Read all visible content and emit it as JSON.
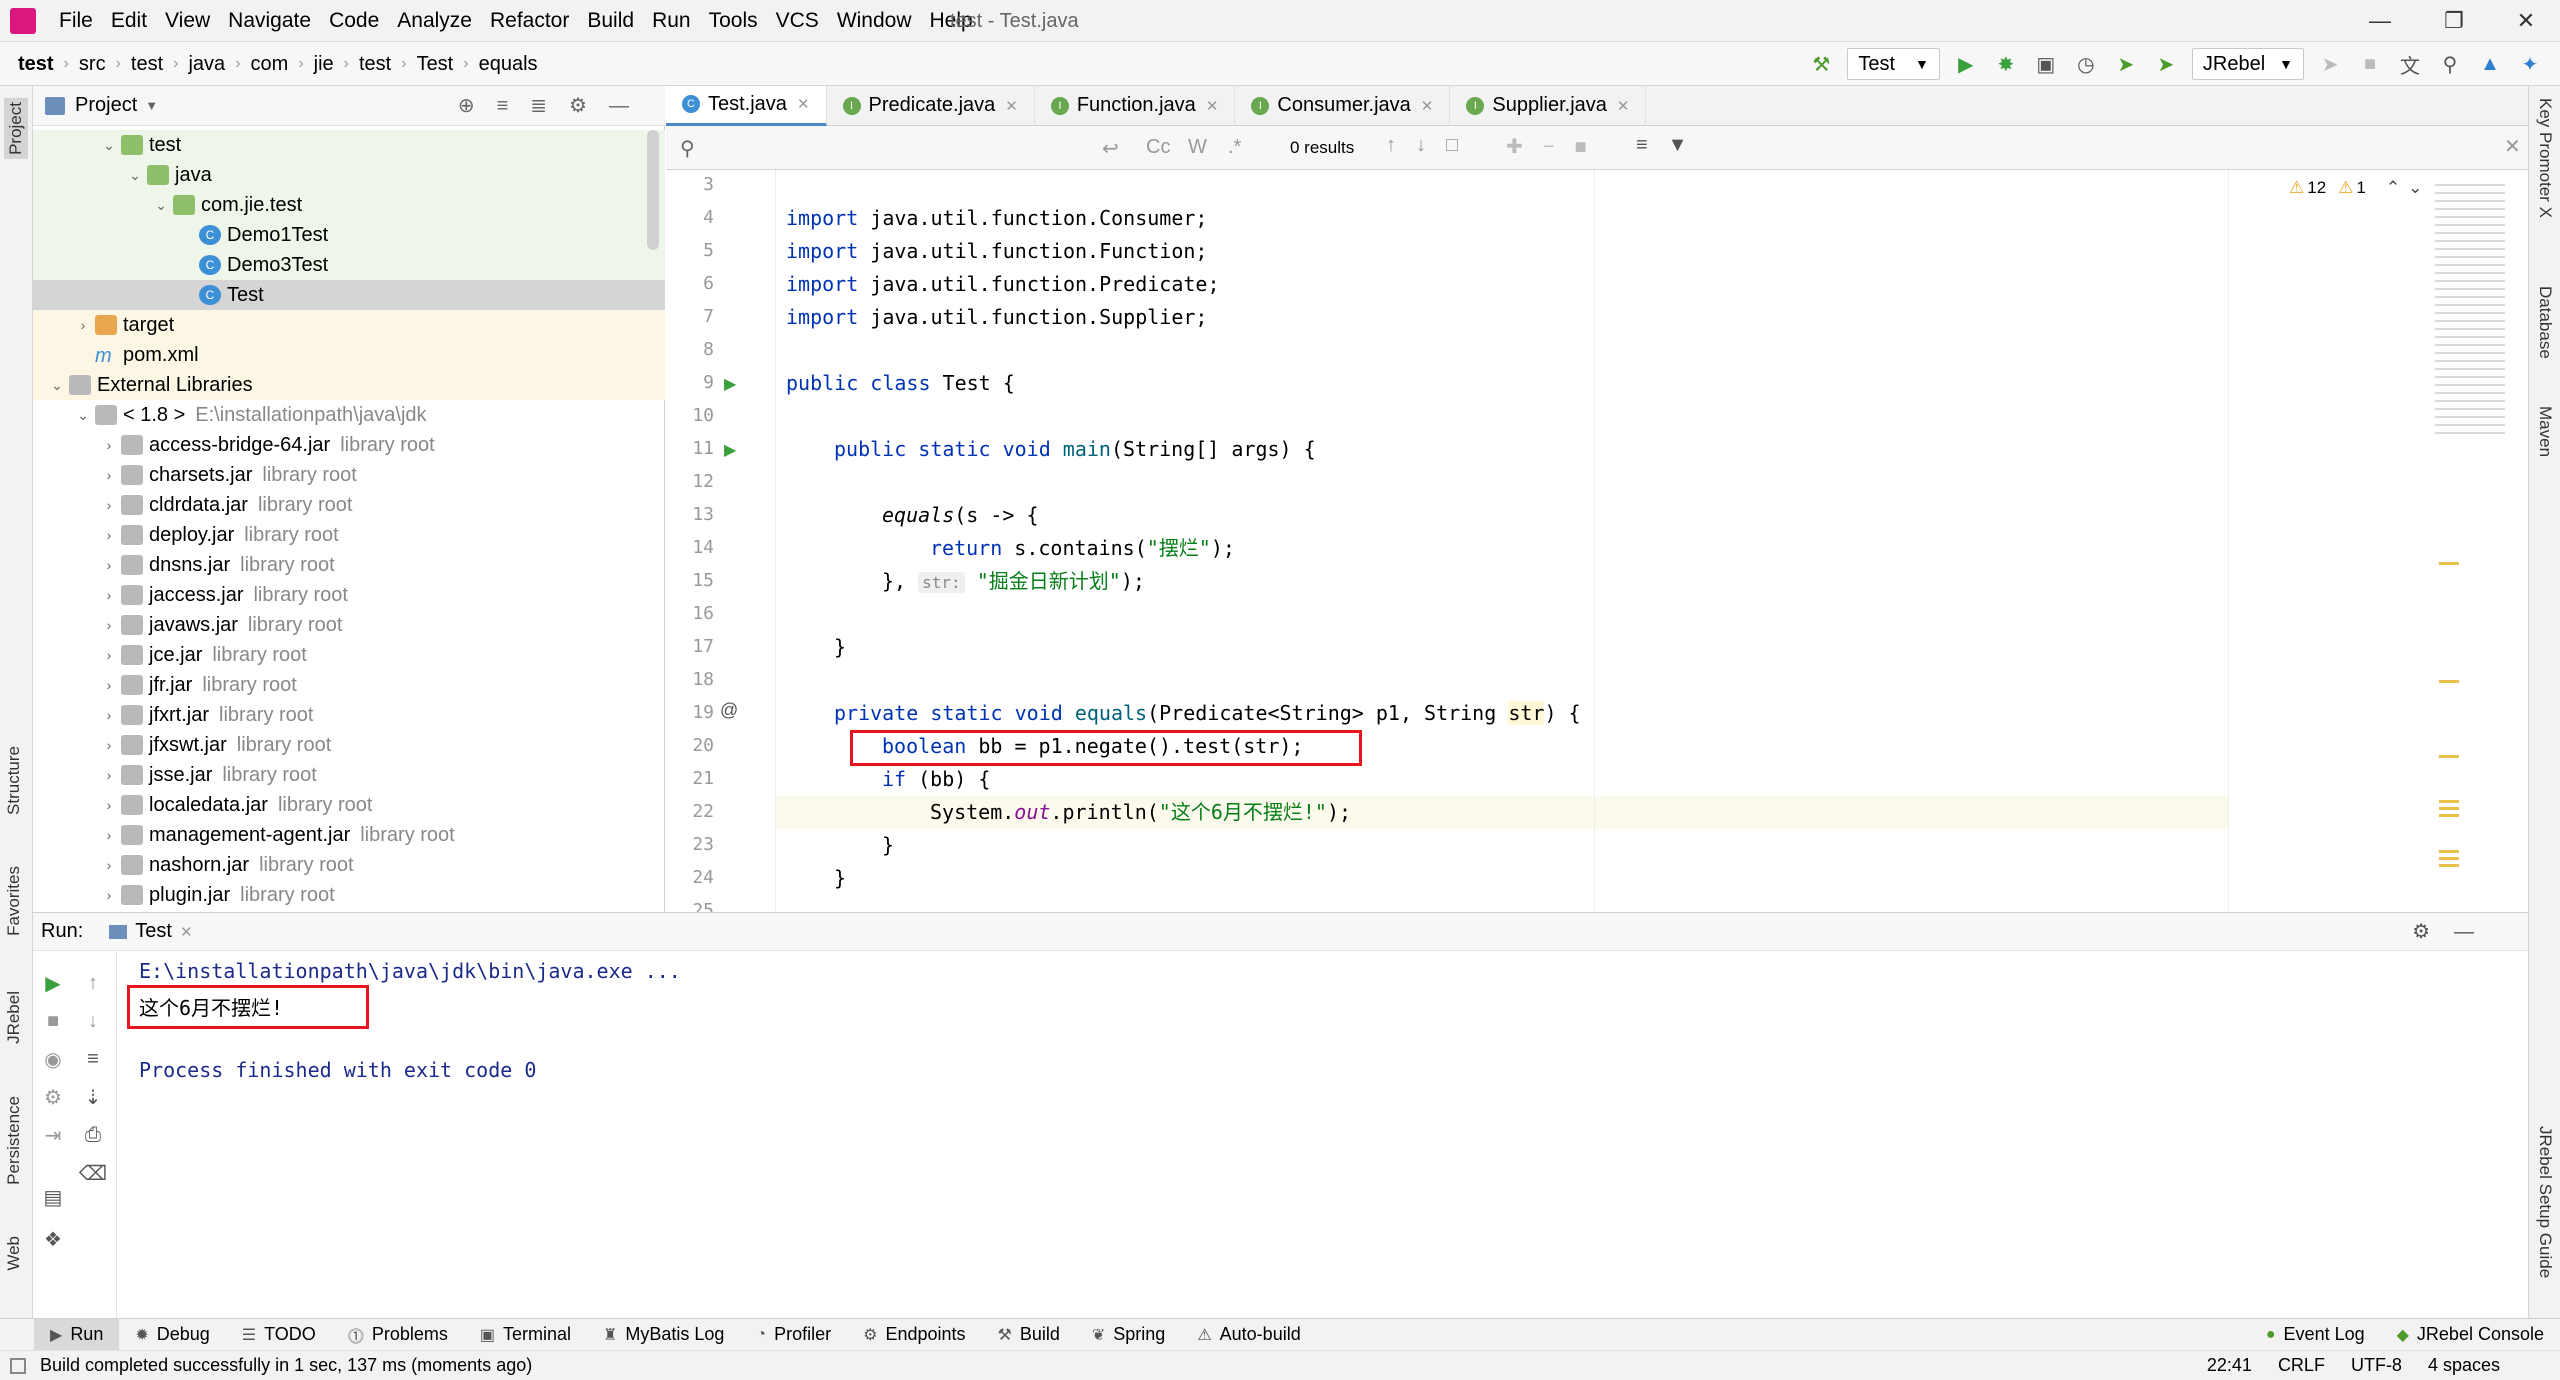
{
  "menu": [
    "File",
    "Edit",
    "View",
    "Navigate",
    "Code",
    "Analyze",
    "Refactor",
    "Build",
    "Run",
    "Tools",
    "VCS",
    "Window",
    "Help"
  ],
  "window_title": "test - Test.java",
  "breadcrumbs": [
    "test",
    "src",
    "test",
    "java",
    "com",
    "jie",
    "test",
    "Test",
    "equals"
  ],
  "toolbar": {
    "run_config": "Test",
    "jrebel": "JRebel"
  },
  "project": {
    "title": "Project",
    "items": [
      {
        "indent": 2,
        "arrow": "v",
        "icon": "fold",
        "label": "test"
      },
      {
        "indent": 3,
        "arrow": "v",
        "icon": "fold",
        "label": "java"
      },
      {
        "indent": 4,
        "arrow": "v",
        "icon": "pkg",
        "label": "com.jie.test"
      },
      {
        "indent": 5,
        "arrow": "",
        "icon": "cls",
        "label": "Demo1Test"
      },
      {
        "indent": 5,
        "arrow": "",
        "icon": "cls",
        "label": "Demo3Test"
      },
      {
        "indent": 5,
        "arrow": "",
        "icon": "cls",
        "label": "Test"
      },
      {
        "indent": 1,
        "arrow": ">",
        "icon": "foldo",
        "label": "target"
      },
      {
        "indent": 1,
        "arrow": "",
        "icon": "m",
        "label": "pom.xml"
      },
      {
        "indent": 0,
        "arrow": "v",
        "icon": "lib",
        "label": "External Libraries"
      },
      {
        "indent": 1,
        "arrow": "v",
        "icon": "jdk",
        "label": "< 1.8 >",
        "extra": "E:\\installationpath\\java\\jdk"
      },
      {
        "indent": 2,
        "arrow": ">",
        "icon": "jar",
        "label": "access-bridge-64.jar",
        "extra": "library root"
      },
      {
        "indent": 2,
        "arrow": ">",
        "icon": "jar",
        "label": "charsets.jar",
        "extra": "library root"
      },
      {
        "indent": 2,
        "arrow": ">",
        "icon": "jar",
        "label": "cldrdata.jar",
        "extra": "library root"
      },
      {
        "indent": 2,
        "arrow": ">",
        "icon": "jar",
        "label": "deploy.jar",
        "extra": "library root"
      },
      {
        "indent": 2,
        "arrow": ">",
        "icon": "jar",
        "label": "dnsns.jar",
        "extra": "library root"
      },
      {
        "indent": 2,
        "arrow": ">",
        "icon": "jar",
        "label": "jaccess.jar",
        "extra": "library root"
      },
      {
        "indent": 2,
        "arrow": ">",
        "icon": "jar",
        "label": "javaws.jar",
        "extra": "library root"
      },
      {
        "indent": 2,
        "arrow": ">",
        "icon": "jar",
        "label": "jce.jar",
        "extra": "library root"
      },
      {
        "indent": 2,
        "arrow": ">",
        "icon": "jar",
        "label": "jfr.jar",
        "extra": "library root"
      },
      {
        "indent": 2,
        "arrow": ">",
        "icon": "jar",
        "label": "jfxrt.jar",
        "extra": "library root"
      },
      {
        "indent": 2,
        "arrow": ">",
        "icon": "jar",
        "label": "jfxswt.jar",
        "extra": "library root"
      },
      {
        "indent": 2,
        "arrow": ">",
        "icon": "jar",
        "label": "jsse.jar",
        "extra": "library root"
      },
      {
        "indent": 2,
        "arrow": ">",
        "icon": "jar",
        "label": "localedata.jar",
        "extra": "library root"
      },
      {
        "indent": 2,
        "arrow": ">",
        "icon": "jar",
        "label": "management-agent.jar",
        "extra": "library root"
      },
      {
        "indent": 2,
        "arrow": ">",
        "icon": "jar",
        "label": "nashorn.jar",
        "extra": "library root"
      },
      {
        "indent": 2,
        "arrow": ">",
        "icon": "jar",
        "label": "plugin.jar",
        "extra": "library root"
      }
    ]
  },
  "tabs": [
    {
      "label": "Test.java",
      "icon": "C",
      "color": "#3d8fd6",
      "active": true
    },
    {
      "label": "Predicate.java",
      "icon": "I",
      "color": "#6aa84f"
    },
    {
      "label": "Function.java",
      "icon": "I",
      "color": "#6aa84f"
    },
    {
      "label": "Consumer.java",
      "icon": "I",
      "color": "#6aa84f"
    },
    {
      "label": "Supplier.java",
      "icon": "I",
      "color": "#6aa84f"
    }
  ],
  "find": {
    "results": "0 results",
    "cc": "Cc",
    "w": "W",
    "regex": ".*"
  },
  "inspections": {
    "warnings": "12",
    "weak": "1"
  },
  "line_numbers": [
    "3",
    "4",
    "5",
    "6",
    "7",
    "8",
    "9",
    "10",
    "11",
    "12",
    "13",
    "14",
    "15",
    "16",
    "17",
    "18",
    "19",
    "20",
    "21",
    "22",
    "23",
    "24",
    "25"
  ],
  "run": {
    "label": "Run:",
    "tab": "Test",
    "lines": [
      "E:\\installationpath\\java\\jdk\\bin\\java.exe ...",
      "这个6月不摆烂!",
      "",
      "Process finished with exit code 0"
    ]
  },
  "left_strip": [
    "Project",
    "Structure",
    "Favorites",
    "JRebel",
    "Persistence",
    "Web"
  ],
  "right_strip": [
    "Key Promoter X",
    "Database",
    "Maven",
    "JRebel Setup Guide"
  ],
  "bottom_tabs": [
    "Run",
    "Debug",
    "TODO",
    "Problems",
    "Terminal",
    "MyBatis Log",
    "Profiler",
    "Endpoints",
    "Build",
    "Spring",
    "Auto-build"
  ],
  "bottom_right": [
    "Event Log",
    "JRebel Console"
  ],
  "status": {
    "message": "Build completed successfully in 1 sec, 137 ms (moments ago)",
    "pos": "22:41",
    "crlf": "CRLF",
    "enc": "UTF-8",
    "indent": "4 spaces"
  },
  "code": {
    "l4": [
      "import",
      "java.util.function.Consumer;"
    ],
    "l5": [
      "import",
      "java.util.function.Function;"
    ],
    "l6": [
      "import",
      "java.util.function.Predicate;"
    ],
    "l7": [
      "import",
      "java.util.function.Supplier;"
    ],
    "l9": [
      "public class",
      "Test {"
    ],
    "l11": [
      "public static void",
      "main",
      "(String[] args) {"
    ],
    "l13": [
      "equals",
      "(s -> {"
    ],
    "l14": [
      "return",
      "s.contains(",
      "\"摆烂\"",
      ");"
    ],
    "l15": [
      "},",
      "str:",
      "\"掘金日新计划\"",
      ");"
    ],
    "l17": "}",
    "l19": [
      "private static void",
      "equals",
      "(Predicate<String> p1, String ",
      "str",
      ") {"
    ],
    "l20": [
      "boolean",
      "bb = p1.negate().test(str);"
    ],
    "l21": [
      "if",
      "(bb) {"
    ],
    "l22": [
      "System.",
      "out",
      ".println(",
      "\"这个6月不摆烂!\"",
      ");"
    ],
    "l23": "}",
    "l24": "}"
  }
}
